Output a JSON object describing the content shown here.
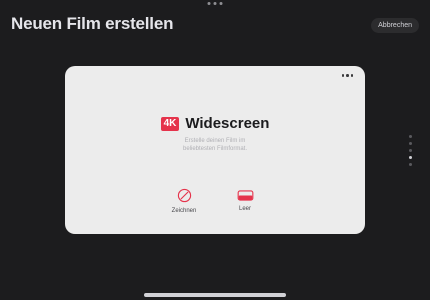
{
  "header": {
    "title": "Neuen Film erstellen",
    "cancel_label": "Abbrechen"
  },
  "card": {
    "badge": "4K",
    "format_name": "Widescreen",
    "description_line1": "Erstelle deinen Film im",
    "description_line2": "beliebtesten Filmformat.",
    "options": [
      {
        "label": "Zeichnen",
        "icon": "pencil-slash-icon"
      },
      {
        "label": "Leer",
        "icon": "empty-frame-icon"
      }
    ]
  },
  "pager": {
    "pages": 5,
    "active_index": 3
  },
  "colors": {
    "accent": "#e5334b",
    "background": "#1c1c1e",
    "card": "#ececec"
  }
}
